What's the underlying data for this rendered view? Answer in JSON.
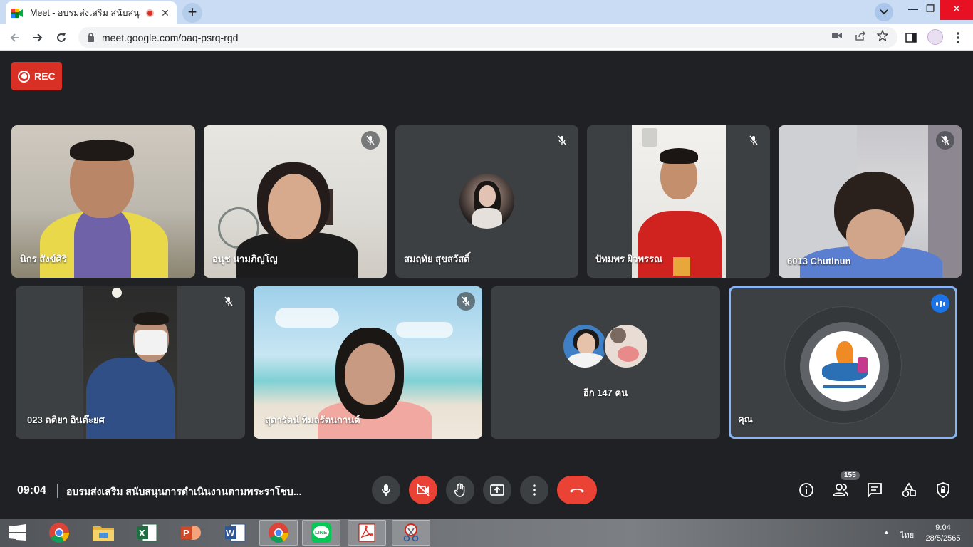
{
  "browser": {
    "tab_title": "Meet - อบรมส่งเสริม สนับสนุนก",
    "tab_close": "✕",
    "new_tab": "+",
    "url": "meet.google.com/oaq-psrq-rgd",
    "window_minimize": "—",
    "window_restore": "❐",
    "window_close": "✕"
  },
  "meet": {
    "rec_label": "REC",
    "participants": [
      {
        "name": "นิกร สังข์ศิริ",
        "muted": false
      },
      {
        "name": "อนุช นามภิญโญ",
        "muted": true
      },
      {
        "name": "สมฤทัย สุขสวัสดิ์",
        "muted": true
      },
      {
        "name": "ปัทมพร ผิวพรรณ",
        "muted": true
      },
      {
        "name": "6013 Chutinun",
        "muted": true
      },
      {
        "name": "023 ดติยา อินต๊ะยศ",
        "muted": true
      },
      {
        "name": "สุดารัตน์ พิมลรัตนกานต์",
        "muted": true
      },
      {
        "name": "อีก 147 คน",
        "muted": false
      },
      {
        "name": "คุณ",
        "muted": false
      }
    ],
    "time": "09:04",
    "title": "อบรมส่งเสริม สนับสนุนการดำเนินงานตามพระราโชบ...",
    "people_count": "155"
  },
  "taskbar": {
    "language": "ไทย",
    "time": "9:04",
    "date": "28/5/2565",
    "tray_up": "▲"
  },
  "colors": {
    "meet_bg": "#202124",
    "tile_bg": "#3c4043",
    "accent_red": "#ea4335",
    "active_speaker": "#8ab4f8"
  }
}
